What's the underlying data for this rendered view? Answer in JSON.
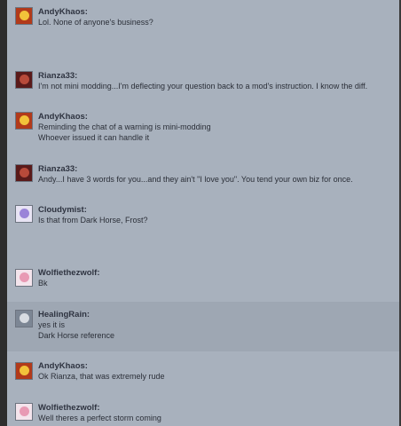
{
  "messages": [
    {
      "user": "AndyKhaos:",
      "avatar": "flame-avatar",
      "lines": [
        "Lol. None of anyone's business?"
      ]
    },
    {
      "user": "Rianza33:",
      "avatar": "dark-red-avatar",
      "lines": [
        "I'm not mini modding...I'm deflecting your question back to a mod's instruction. I know the diff."
      ]
    },
    {
      "user": "AndyKhaos:",
      "avatar": "flame-avatar",
      "lines": [
        "Reminding the chat of a warning is mini-modding",
        "Whoever issued it can handle it"
      ]
    },
    {
      "user": "Rianza33:",
      "avatar": "dark-red-avatar",
      "lines": [
        "Andy...I have 3 words for you...and they ain't \"I love you\". You tend your own biz for once."
      ]
    },
    {
      "user": "Cloudymist:",
      "avatar": "purple-anime-avatar",
      "lines": [
        "Is that from Dark Horse, Frost?"
      ]
    },
    {
      "user": "Wolfiethezwolf:",
      "avatar": "pink-anime-avatar",
      "lines": [
        "Bk"
      ]
    },
    {
      "user": "HealingRain:",
      "avatar": "gray-anime-avatar",
      "lines": [
        "yes it is",
        "Dark Horse reference"
      ]
    },
    {
      "user": "AndyKhaos:",
      "avatar": "flame-avatar",
      "lines": [
        "Ok Rianza, that was extremely rude"
      ]
    },
    {
      "user": "Wolfiethezwolf:",
      "avatar": "pink-anime-avatar",
      "lines": [
        "Well theres a perfect storm coming"
      ]
    }
  ],
  "colors": {
    "background": "#a8b1bd",
    "highlight": "#9ea7b3",
    "name": "#2e3340",
    "text": "#2b2f38"
  }
}
